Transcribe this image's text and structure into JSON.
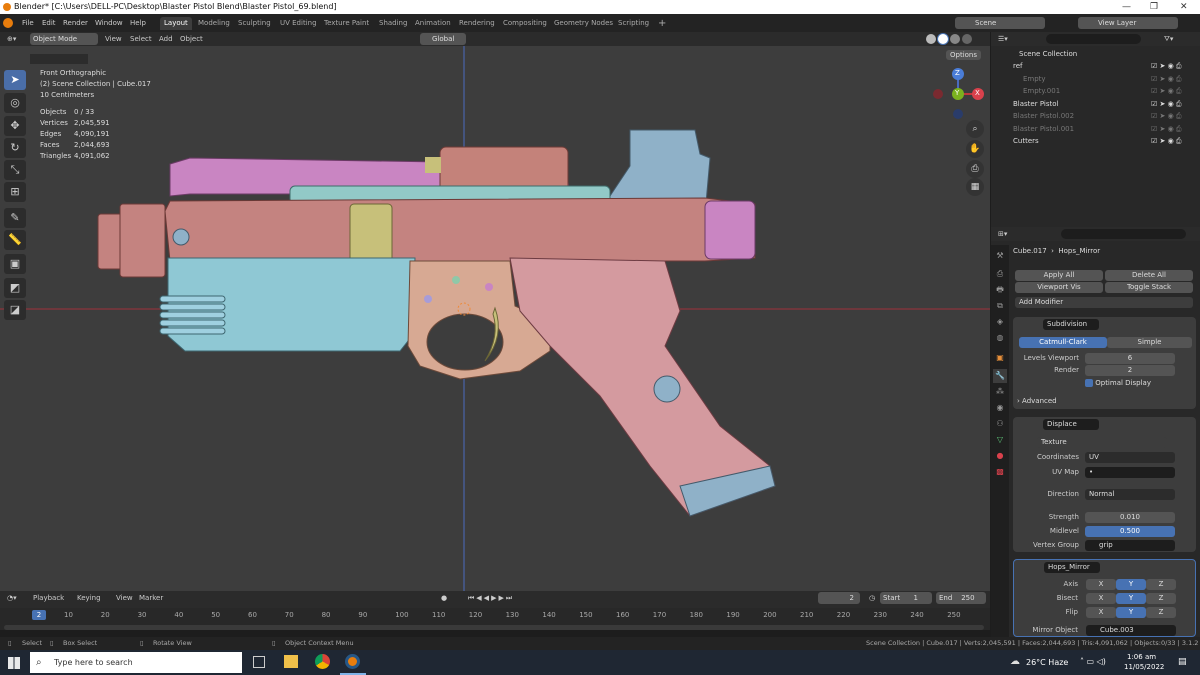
{
  "window": {
    "title": "Blender* [C:\\Users\\DELL-PC\\Desktop\\Blaster Pistol Blend\\Blaster Pistol_69.blend]",
    "min": "—",
    "max": "❐",
    "close": "✕"
  },
  "menu": [
    "File",
    "Edit",
    "Render",
    "Window",
    "Help"
  ],
  "workspaces": [
    "Layout",
    "Modeling",
    "Sculpting",
    "UV Editing",
    "Texture Paint",
    "Shading",
    "Animation",
    "Rendering",
    "Compositing",
    "Geometry Nodes",
    "Scripting"
  ],
  "workspace_add": "+",
  "scene": {
    "label": "Scene",
    "view_layer": "View Layer"
  },
  "header": {
    "mode": "Object Mode",
    "view": "View",
    "select": "Select",
    "add": "Add",
    "object": "Object",
    "transform": "Global",
    "options": "Options"
  },
  "viewport": {
    "view_name": "Front Orthographic",
    "collection": "(2) Scene Collection | Cube.017",
    "scale": "10 Centimeters",
    "stats": [
      {
        "k": "Objects",
        "v": "0 / 33"
      },
      {
        "k": "Vertices",
        "v": "2,045,591"
      },
      {
        "k": "Edges",
        "v": "4,090,191"
      },
      {
        "k": "Faces",
        "v": "2,044,693"
      },
      {
        "k": "Triangles",
        "v": "4,091,062"
      }
    ],
    "gizmo": {
      "z": "Z",
      "y": "Y",
      "x": "X"
    }
  },
  "timeline": {
    "playback": "Playback",
    "keying": "Keying",
    "view": "View",
    "marker": "Marker",
    "current": "2",
    "start_label": "Start",
    "start": "1",
    "end_label": "End",
    "end": "250",
    "frames": [
      "10",
      "20",
      "30",
      "40",
      "50",
      "60",
      "70",
      "80",
      "90",
      "100",
      "110",
      "120",
      "130",
      "140",
      "150",
      "160",
      "170",
      "180",
      "190",
      "200",
      "210",
      "220",
      "230",
      "240",
      "250"
    ],
    "playhead": "2"
  },
  "statusbar": {
    "select": "Select",
    "box_select": "Box Select",
    "rotate": "Rotate View",
    "context": "Object Context Menu",
    "info": "Scene Collection | Cube.017 | Verts:2,045,591 | Faces:2,044,693 | Tris:4,091,062 | Objects:0/33 | 3.1.2"
  },
  "outliner": {
    "root": "Scene Collection",
    "items": [
      {
        "name": "ref",
        "indent": 1,
        "dim": false
      },
      {
        "name": "Empty",
        "indent": 2,
        "dim": true
      },
      {
        "name": "Empty.001",
        "indent": 2,
        "dim": true
      },
      {
        "name": "Blaster Pistol",
        "indent": 1,
        "dim": false
      },
      {
        "name": "Blaster Pistol.002",
        "indent": 1,
        "dim": true
      },
      {
        "name": "Blaster Pistol.001",
        "indent": 1,
        "dim": true
      },
      {
        "name": "Cutters",
        "indent": 1,
        "dim": false
      }
    ]
  },
  "properties": {
    "object": "Cube.017",
    "modifier_active": "Hops_Mirror",
    "apply_all": "Apply All",
    "delete_all": "Delete All",
    "viewport_vis": "Viewport Vis",
    "toggle_stack": "Toggle Stack",
    "add_modifier": "Add Modifier",
    "subdivision": {
      "name": "Subdivision",
      "catmull": "Catmull-Clark",
      "simple": "Simple",
      "levels_label": "Levels Viewport",
      "levels": "6",
      "render_label": "Render",
      "render": "2",
      "optimal": "Optimal Display",
      "advanced": "Advanced"
    },
    "displace": {
      "name": "Displace",
      "texture": "Texture",
      "coords_label": "Coordinates",
      "coords": "UV",
      "uvmap_label": "UV Map",
      "uvmap": "•",
      "direction_label": "Direction",
      "direction": "Normal",
      "strength_label": "Strength",
      "strength": "0.010",
      "midlevel_label": "Midlevel",
      "midlevel": "0.500",
      "vgroup_label": "Vertex Group",
      "vgroup": "grip"
    },
    "mirror": {
      "name": "Hops_Mirror",
      "axis_label": "Axis",
      "bisect_label": "Bisect",
      "flip_label": "Flip",
      "x": "X",
      "y": "Y",
      "z": "Z",
      "mirror_obj_label": "Mirror Object",
      "mirror_obj": "Cube.003"
    }
  },
  "taskbar": {
    "search": "Type here to search",
    "weather": "26°C Haze",
    "time": "1:06 am",
    "date": "11/05/2022"
  }
}
